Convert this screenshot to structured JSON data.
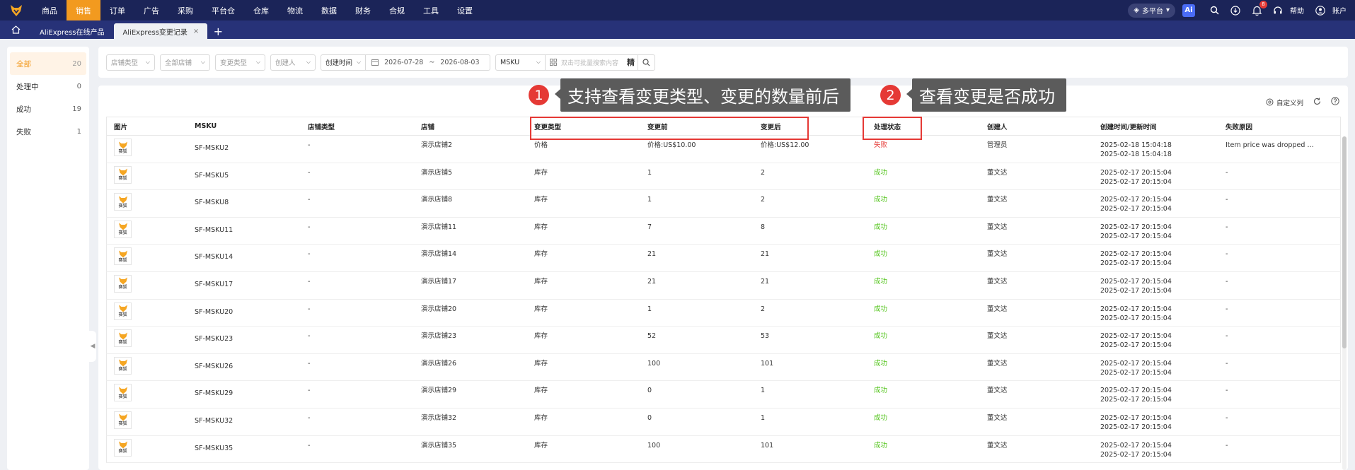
{
  "topnav": {
    "items": [
      "商品",
      "销售",
      "订单",
      "广告",
      "采购",
      "平台仓",
      "仓库",
      "物流",
      "数据",
      "财务",
      "合规",
      "工具",
      "设置"
    ],
    "active_index": 1,
    "platform_label": "多平台",
    "ai_label": "Ai",
    "notification_count": "8",
    "help_label": "帮助",
    "account_label": "账户"
  },
  "tabs": {
    "items": [
      {
        "label": "AliExpress在线产品",
        "active": false
      },
      {
        "label": "AliExpress变更记录",
        "active": true
      }
    ],
    "close_label": "×",
    "add_label": "+"
  },
  "sidebar": {
    "items": [
      {
        "label": "全部",
        "count": "20",
        "active": true
      },
      {
        "label": "处理中",
        "count": "0"
      },
      {
        "label": "成功",
        "count": "19"
      },
      {
        "label": "失败",
        "count": "1"
      }
    ]
  },
  "filters": {
    "shop_type": "店铺类型",
    "all_shops": "全部店铺",
    "change_type": "变更类型",
    "creator": "创建人",
    "time_type": "创建时间",
    "date_start": "2026-07-28",
    "date_sep": "~",
    "date_end": "2026-08-03",
    "search_field": "MSKU",
    "search_placeholder": "双击可批量搜索内容",
    "precise_label": "精"
  },
  "toolbar": {
    "custom_columns": "自定义列"
  },
  "table": {
    "headers": [
      "图片",
      "MSKU",
      "店铺类型",
      "店铺",
      "变更类型",
      "变更前",
      "变更后",
      "处理状态",
      "创建人",
      "创建时间/更新时间",
      "失败原因"
    ],
    "thumb_text": "赛狐",
    "rows": [
      {
        "msku": "SF-MSKU2",
        "shop_type": "-",
        "shop": "演示店铺2",
        "change_type": "价格",
        "before": "价格:US$10.00",
        "after": "价格:US$12.00",
        "status": "失败",
        "status_kind": "fail",
        "creator": "管理员",
        "created": "2025-02-18 15:04:18",
        "updated": "2025-02-18 15:04:18",
        "reason": "Item price was dropped by too large a margin"
      },
      {
        "msku": "SF-MSKU5",
        "shop_type": "-",
        "shop": "演示店铺5",
        "change_type": "库存",
        "before": "1",
        "after": "2",
        "status": "成功",
        "status_kind": "ok",
        "creator": "董文达",
        "created": "2025-02-17 20:15:04",
        "updated": "2025-02-17 20:15:04",
        "reason": "-"
      },
      {
        "msku": "SF-MSKU8",
        "shop_type": "-",
        "shop": "演示店铺8",
        "change_type": "库存",
        "before": "1",
        "after": "2",
        "status": "成功",
        "status_kind": "ok",
        "creator": "董文达",
        "created": "2025-02-17 20:15:04",
        "updated": "2025-02-17 20:15:04",
        "reason": "-"
      },
      {
        "msku": "SF-MSKU11",
        "shop_type": "-",
        "shop": "演示店铺11",
        "change_type": "库存",
        "before": "7",
        "after": "8",
        "status": "成功",
        "status_kind": "ok",
        "creator": "董文达",
        "created": "2025-02-17 20:15:04",
        "updated": "2025-02-17 20:15:04",
        "reason": "-"
      },
      {
        "msku": "SF-MSKU14",
        "shop_type": "-",
        "shop": "演示店铺14",
        "change_type": "库存",
        "before": "21",
        "after": "21",
        "status": "成功",
        "status_kind": "ok",
        "creator": "董文达",
        "created": "2025-02-17 20:15:04",
        "updated": "2025-02-17 20:15:04",
        "reason": "-"
      },
      {
        "msku": "SF-MSKU17",
        "shop_type": "-",
        "shop": "演示店铺17",
        "change_type": "库存",
        "before": "21",
        "after": "21",
        "status": "成功",
        "status_kind": "ok",
        "creator": "董文达",
        "created": "2025-02-17 20:15:04",
        "updated": "2025-02-17 20:15:04",
        "reason": "-"
      },
      {
        "msku": "SF-MSKU20",
        "shop_type": "-",
        "shop": "演示店铺20",
        "change_type": "库存",
        "before": "1",
        "after": "2",
        "status": "成功",
        "status_kind": "ok",
        "creator": "董文达",
        "created": "2025-02-17 20:15:04",
        "updated": "2025-02-17 20:15:04",
        "reason": "-"
      },
      {
        "msku": "SF-MSKU23",
        "shop_type": "-",
        "shop": "演示店铺23",
        "change_type": "库存",
        "before": "52",
        "after": "53",
        "status": "成功",
        "status_kind": "ok",
        "creator": "董文达",
        "created": "2025-02-17 20:15:04",
        "updated": "2025-02-17 20:15:04",
        "reason": "-"
      },
      {
        "msku": "SF-MSKU26",
        "shop_type": "-",
        "shop": "演示店铺26",
        "change_type": "库存",
        "before": "100",
        "after": "101",
        "status": "成功",
        "status_kind": "ok",
        "creator": "董文达",
        "created": "2025-02-17 20:15:04",
        "updated": "2025-02-17 20:15:04",
        "reason": "-"
      },
      {
        "msku": "SF-MSKU29",
        "shop_type": "-",
        "shop": "演示店铺29",
        "change_type": "库存",
        "before": "0",
        "after": "1",
        "status": "成功",
        "status_kind": "ok",
        "creator": "董文达",
        "created": "2025-02-17 20:15:04",
        "updated": "2025-02-17 20:15:04",
        "reason": "-"
      },
      {
        "msku": "SF-MSKU32",
        "shop_type": "-",
        "shop": "演示店铺32",
        "change_type": "库存",
        "before": "0",
        "after": "1",
        "status": "成功",
        "status_kind": "ok",
        "creator": "董文达",
        "created": "2025-02-17 20:15:04",
        "updated": "2025-02-17 20:15:04",
        "reason": "-"
      },
      {
        "msku": "SF-MSKU35",
        "shop_type": "-",
        "shop": "演示店铺35",
        "change_type": "库存",
        "before": "100",
        "after": "101",
        "status": "成功",
        "status_kind": "ok",
        "creator": "董文达",
        "created": "2025-02-17 20:15:04",
        "updated": "2025-02-17 20:15:04",
        "reason": "-"
      }
    ]
  },
  "callouts": [
    {
      "number": "1",
      "text": "支持查看变更类型、变更的数量前后"
    },
    {
      "number": "2",
      "text": "查看变更是否成功"
    }
  ],
  "colors": {
    "nav_bg": "#1b2458",
    "tab_bg": "#273278",
    "accent": "#f29a1f",
    "fail": "#e53935",
    "success": "#52c41a",
    "callout_bg": "#5b5b5b"
  }
}
